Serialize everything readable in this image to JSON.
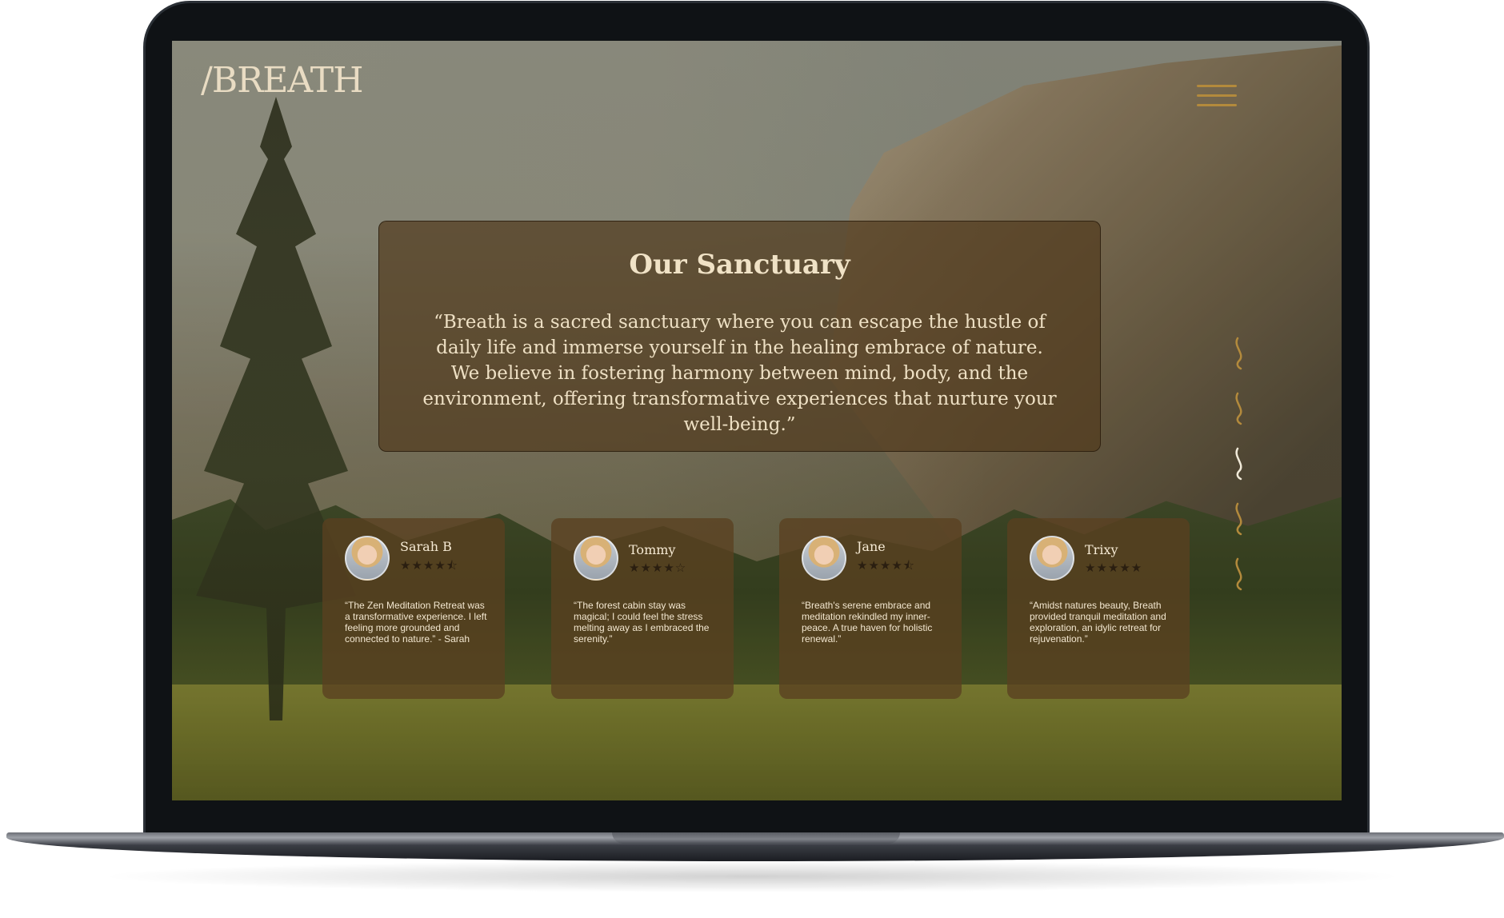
{
  "site": {
    "logo": "/BREATH"
  },
  "hero": {
    "title": "Our Sanctuary",
    "quote": "“Breath is a sacred sanctuary where you can escape the hustle of daily life and immerse yourself in the healing embrace of nature. We believe in fostering harmony between mind, body, and the environment, offering transformative experiences that nurture your well-being.”"
  },
  "slider": {
    "count": 5,
    "active_index": 2,
    "active_color": "#f1ead9",
    "inactive_color": "#b38a3c"
  },
  "testimonials": [
    {
      "name": "Sarah B",
      "stars": "★★★★⯪",
      "rating": 4.5,
      "text": "“The Zen Meditation Retreat was a transformative experience. I left feeling more grounded and connected to nature.” - Sarah"
    },
    {
      "name": "Tommy",
      "stars": "★★★★☆",
      "rating": 4,
      "text": "“The forest cabin stay was magical; I could feel the stress melting away as I embraced the serenity.”"
    },
    {
      "name": "Jane",
      "stars": "★★★★⯪",
      "rating": 4.5,
      "text": "“Breath's serene embrace and meditation rekindled my inner-peace. A true haven for holistic renewal.”"
    },
    {
      "name": "Trixy",
      "stars": "★★★★★",
      "rating": 5,
      "text": "“Amidst natures beauty, Breath provided tranquil meditation and exploration, an idylic retreat for rejuvenation.”"
    }
  ],
  "colors": {
    "accent": "#b38a3c",
    "card_bg": "#523c1e",
    "text_light": "#f0e2c6"
  }
}
